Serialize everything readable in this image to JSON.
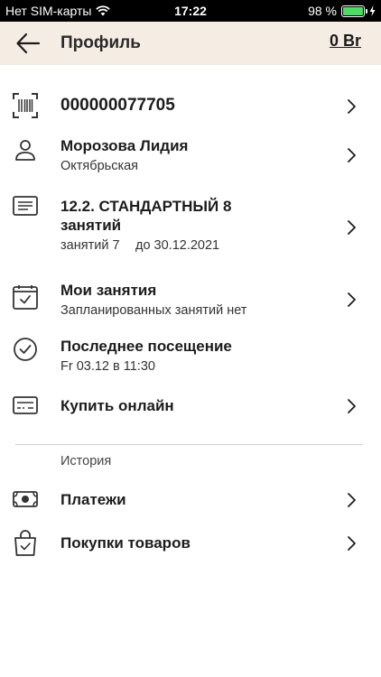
{
  "status_bar": {
    "carrier": "Нет SIM-карты",
    "time": "17:22",
    "battery": "98 %"
  },
  "header": {
    "title": "Профиль",
    "balance": "0 Br"
  },
  "card": {
    "number": "000000077705"
  },
  "client": {
    "name": "Морозова Лидия",
    "branch": "Октябрьская"
  },
  "subscription": {
    "title_line1": "12.2. СТАНДАРТНЫЙ 8",
    "title_line2": "занятий",
    "remaining": "занятий 7",
    "until": "до 30.12.2021"
  },
  "lessons": {
    "title": "Мои занятия",
    "subtitle": "Запланированных занятий нет"
  },
  "last_visit": {
    "title": "Последнее посещение",
    "value": "Fr 03.12 в 11:30"
  },
  "buy_online": {
    "title": "Купить онлайн"
  },
  "history": {
    "section_label": "История",
    "payments": "Платежи",
    "purchases": "Покупки товаров"
  },
  "icons": {
    "back": "arrow-left-icon",
    "barcode": "barcode-icon",
    "person": "person-icon",
    "document": "document-icon",
    "calendar": "calendar-check-icon",
    "check": "check-circle-icon",
    "card": "credit-card-icon",
    "money": "banknote-icon",
    "bag": "shopping-bag-icon",
    "chevron": "chevron-right-icon"
  }
}
